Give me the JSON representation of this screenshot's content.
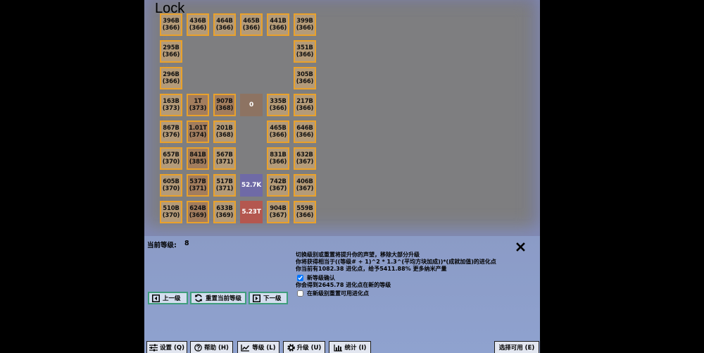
{
  "title": "Lock",
  "colors": {
    "tile_fill": "#b49b79",
    "tile_border": "#e9a12b",
    "panel_bg": "#8fa2cf",
    "button_border": "#3f9d7c"
  },
  "board": [
    [
      {
        "value": "396B",
        "level": "(366)"
      },
      {
        "value": "436B",
        "level": "(366)"
      },
      {
        "value": "464B",
        "level": "(366)"
      },
      {
        "value": "465B",
        "level": "(366)"
      },
      {
        "value": "441B",
        "level": "(366)"
      },
      {
        "value": "399B",
        "level": "(366)"
      }
    ],
    [
      {
        "value": "295B",
        "level": "(366)"
      },
      null,
      null,
      null,
      null,
      {
        "value": "351B",
        "level": "(366)"
      }
    ],
    [
      {
        "value": "296B",
        "level": "(366)"
      },
      null,
      null,
      null,
      null,
      {
        "value": "305B",
        "level": "(366)"
      }
    ],
    [
      {
        "value": "163B",
        "level": "(373)"
      },
      {
        "value": "1T",
        "level": "(373)",
        "fill": "#a27d5e"
      },
      {
        "value": "907B",
        "level": "(368)",
        "fill": "#a27d5e"
      },
      {
        "value": "0",
        "fill": "#8d7362"
      },
      {
        "value": "335B",
        "level": "(366)"
      },
      {
        "value": "217B",
        "level": "(366)"
      }
    ],
    [
      {
        "value": "867B",
        "level": "(376)"
      },
      {
        "value": "1.01T",
        "level": "(374)",
        "fill": "#a27d5e"
      },
      {
        "value": "201B",
        "level": "(368)"
      },
      null,
      {
        "value": "465B",
        "level": "(366)"
      },
      {
        "value": "646B",
        "level": "(366)"
      }
    ],
    [
      {
        "value": "657B",
        "level": "(370)"
      },
      {
        "value": "841B",
        "level": "(385)",
        "fill": "#a27d5e"
      },
      {
        "value": "567B",
        "level": "(371)"
      },
      null,
      {
        "value": "831B",
        "level": "(366)"
      },
      {
        "value": "632B",
        "level": "(367)"
      }
    ],
    [
      {
        "value": "605B",
        "level": "(370)"
      },
      {
        "value": "537B",
        "level": "(371)",
        "fill": "#a27d5e"
      },
      {
        "value": "517B",
        "level": "(371)"
      },
      {
        "value": "52.7K",
        "fill": "#6f6aa6"
      },
      {
        "value": "742B",
        "level": "(367)"
      },
      {
        "value": "406B",
        "level": "(367)"
      }
    ],
    [
      {
        "value": "510B",
        "level": "(370)"
      },
      {
        "value": "624B",
        "level": "(369)",
        "fill": "#a27d5e"
      },
      {
        "value": "633B",
        "level": "(369)"
      },
      {
        "value": "5.23T",
        "fill": "#b4574f"
      },
      {
        "value": "904B",
        "level": "(367)"
      },
      {
        "value": "559B",
        "level": "(366)"
      }
    ]
  ],
  "panel": {
    "level_label": "当前等级:",
    "level_value": "8",
    "close_icon": "close-icon",
    "info": [
      "切换级别或重置将提升你的声望，移除大部分升级",
      "你将获得相当于((等级# + 1)^2 * 1.3^(平均方块加成))*(成就加值)的进化点",
      "你当前有1082.38 进化点，给予5411.88% 更多纳米产量"
    ],
    "confirm": {
      "label": "新等级确认",
      "checked": true
    },
    "gain_text": "你会得到2645.78 进化点在新的等级",
    "reset_points": {
      "label": "在新级别重置可用进化点",
      "checked": false
    },
    "buttons": {
      "prev": {
        "label": "上一级",
        "icon": "prev-level-icon"
      },
      "reset": {
        "label": "重置当前等级",
        "icon": "refresh-icon"
      },
      "next": {
        "label": "下一级",
        "icon": "next-level-icon"
      }
    }
  },
  "nav": [
    {
      "label": "设置 (Q)",
      "icon": "sliders-icon"
    },
    {
      "label": "帮助 (H)",
      "icon": "help-icon"
    },
    {
      "label": "等级 (L)",
      "icon": "line-chart-icon"
    },
    {
      "label": "升级 (U)",
      "icon": "gear-icon"
    },
    {
      "label": "统计 (I)",
      "icon": "bar-chart-icon"
    }
  ],
  "nav_right": {
    "label": "选择可用 (E)"
  }
}
